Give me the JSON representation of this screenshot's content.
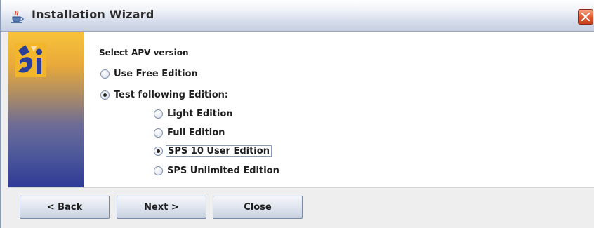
{
  "window": {
    "title": "Installation Wizard",
    "title_icon": "java-cup-icon",
    "close_icon": "close-icon"
  },
  "banner": {
    "logo_icon": "apv-logo-icon"
  },
  "content": {
    "heading": "Select APV version",
    "options": [
      {
        "label": "Use Free Edition",
        "selected": false
      },
      {
        "label": "Test following Edition:",
        "selected": true
      }
    ],
    "editions": [
      {
        "label": "Light Edition",
        "selected": false
      },
      {
        "label": "Full Edition",
        "selected": false
      },
      {
        "label": "SPS 10 User Edition",
        "selected": true,
        "focused": true
      },
      {
        "label": "SPS Unlimited Edition",
        "selected": false
      }
    ]
  },
  "buttons": {
    "back": "< Back",
    "next": "Next >",
    "close": "Close"
  },
  "colors": {
    "close_button": "#e0562f",
    "banner_top": "#f8c33a",
    "banner_bottom": "#2f3a95"
  }
}
